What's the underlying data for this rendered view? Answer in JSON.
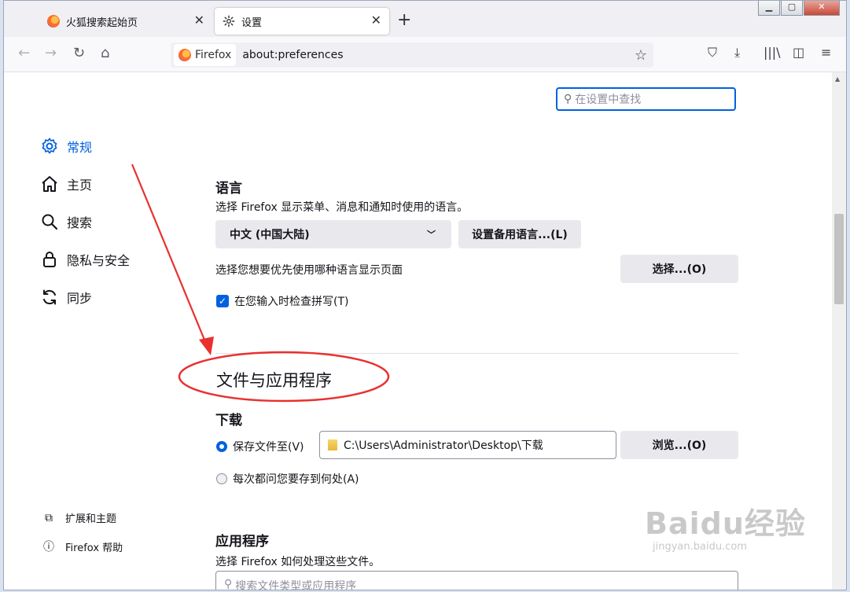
{
  "tabs": [
    {
      "label": "火狐搜索起始页"
    },
    {
      "label": "设置"
    }
  ],
  "urlbar": {
    "identity": "Firefox",
    "url": "about:preferences"
  },
  "search": {
    "placeholder": "在设置中查找"
  },
  "sidebar": {
    "items": [
      {
        "label": "常规",
        "icon": "gear-icon"
      },
      {
        "label": "主页",
        "icon": "home-icon"
      },
      {
        "label": "搜索",
        "icon": "search-icon"
      },
      {
        "label": "隐私与安全",
        "icon": "lock-icon"
      },
      {
        "label": "同步",
        "icon": "sync-icon"
      }
    ],
    "footer": [
      {
        "label": "扩展和主题",
        "icon": "puzzle-icon"
      },
      {
        "label": "Firefox 帮助",
        "icon": "help-icon"
      }
    ]
  },
  "language": {
    "title": "语言",
    "desc": "选择 Firefox 显示菜单、消息和通知时使用的语言。",
    "selected": "中文 (中国大陆)",
    "alt_button": "设置备用语言...(L)",
    "pages_desc": "选择您想要优先使用哪种语言显示页面",
    "choose_button": "选择...(O)",
    "spellcheck_label": "在您输入时检查拼写(T)"
  },
  "files": {
    "section_title": "文件与应用程序",
    "download_title": "下载",
    "save_to_label": "保存文件至(V)",
    "path": "C:\\Users\\Administrator\\Desktop\\下载",
    "browse_button": "浏览...(O)",
    "ask_label": "每次都问您要存到何处(A)"
  },
  "apps": {
    "title": "应用程序",
    "desc": "选择 Firefox 如何处理这些文件。",
    "search_placeholder": "搜索文件类型或应用程序"
  },
  "watermark": {
    "logo": "Baidu经验",
    "url": "jingyan.baidu.com"
  },
  "colors": {
    "accent": "#0061e0",
    "annotation": "#e8312f"
  }
}
